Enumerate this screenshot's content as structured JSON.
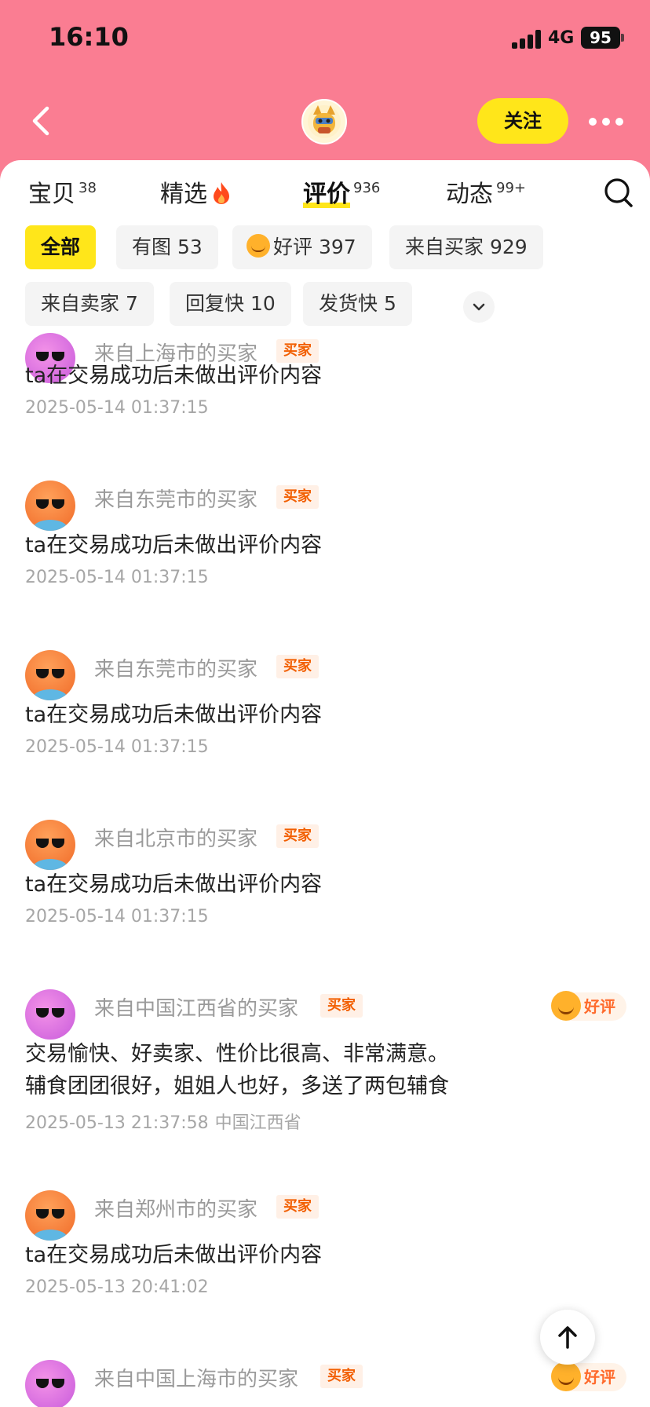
{
  "status_bar": {
    "time": "16:10",
    "network": "4G",
    "battery": "95"
  },
  "header": {
    "follow_label": "关注"
  },
  "tabs": [
    {
      "label": "宝贝",
      "count": "38"
    },
    {
      "label": "精选",
      "count": ""
    },
    {
      "label": "评价",
      "count": "936"
    },
    {
      "label": "动态",
      "count": "99+"
    }
  ],
  "filters": [
    {
      "label": "全部"
    },
    {
      "label": "有图 53"
    },
    {
      "label": "好评 397"
    },
    {
      "label": "来自买家 929"
    },
    {
      "label": "来自卖家 7"
    },
    {
      "label": "回复快 10"
    },
    {
      "label": "发货快 5"
    }
  ],
  "reviews": [
    {
      "user": "来自上海市的买家",
      "tag": "买家",
      "text": "ta在交易成功后未做出评价内容",
      "date": "2025-05-14 01:37:15"
    },
    {
      "user": "来自东莞市的买家",
      "tag": "买家",
      "text": "ta在交易成功后未做出评价内容",
      "date": "2025-05-14 01:37:15"
    },
    {
      "user": "来自东莞市的买家",
      "tag": "买家",
      "text": "ta在交易成功后未做出评价内容",
      "date": "2025-05-14 01:37:15"
    },
    {
      "user": "来自北京市的买家",
      "tag": "买家",
      "text": "ta在交易成功后未做出评价内容",
      "date": "2025-05-14 01:37:15"
    },
    {
      "user": "来自中国江西省的买家",
      "tag": "买家",
      "badge": "好评",
      "text_line1": "交易愉快、好卖家、性价比很高、非常满意。",
      "text_line2": "辅食团团很好，姐姐人也好，多送了两包辅食",
      "date": "2025-05-13 21:37:58",
      "location": "中国江西省"
    },
    {
      "user": "来自郑州市的买家",
      "tag": "买家",
      "text": "ta在交易成功后未做出评价内容",
      "date": "2025-05-13 20:41:02"
    },
    {
      "user": "来自中国上海市的买家",
      "tag": "买家",
      "badge": "好评"
    }
  ],
  "colors": {
    "header_bg": "#FA7D92",
    "accent_yellow": "#FFE61A",
    "tag_orange": "#F25E00"
  },
  "icons": [
    "back-arrow-icon",
    "shop-avatar-icon",
    "more-icon",
    "fire-icon",
    "search-icon",
    "chevron-down-icon",
    "arrow-up-icon"
  ]
}
